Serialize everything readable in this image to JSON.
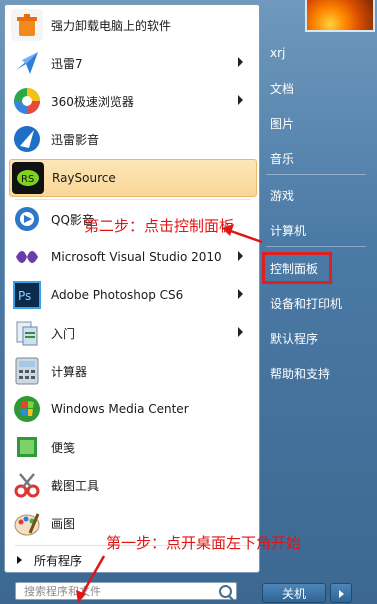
{
  "left_items": [
    {
      "label": "强力卸载电脑上的软件",
      "icon": "uninstall-icon",
      "arrow": false
    },
    {
      "label": "迅雷7",
      "icon": "xunlei-icon",
      "arrow": true
    },
    {
      "label": "360极速浏览器",
      "icon": "browser-icon",
      "arrow": true
    },
    {
      "label": "迅雷影音",
      "icon": "media-player-icon",
      "arrow": false
    },
    {
      "label": "RaySource",
      "icon": "raysource-icon",
      "arrow": false,
      "selected": true
    },
    {
      "label": "QQ影音",
      "icon": "qq-player-icon",
      "arrow": false
    },
    {
      "label": "Microsoft Visual Studio 2010",
      "icon": "visual-studio-icon",
      "arrow": true
    },
    {
      "label": "Adobe Photoshop CS6",
      "icon": "photoshop-icon",
      "arrow": true
    },
    {
      "label": "入门",
      "icon": "getting-started-icon",
      "arrow": true
    },
    {
      "label": "计算器",
      "icon": "calculator-icon",
      "arrow": false
    },
    {
      "label": "Windows Media Center",
      "icon": "media-center-icon",
      "arrow": false
    },
    {
      "label": "便笺",
      "icon": "sticky-notes-icon",
      "arrow": false
    },
    {
      "label": "截图工具",
      "icon": "snipping-tool-icon",
      "arrow": false
    },
    {
      "label": "画图",
      "icon": "paint-icon",
      "arrow": false
    }
  ],
  "all_programs": "所有程序",
  "search_placeholder": "搜索程序和文件",
  "right_items": {
    "user": "xrj",
    "documents": "文档",
    "pictures": "图片",
    "music": "音乐",
    "games": "游戏",
    "computer": "计算机",
    "control_panel": "控制面板",
    "devices": "设备和打印机",
    "default_programs": "默认程序",
    "help": "帮助和支持"
  },
  "shutdown_label": "关机",
  "annotations": {
    "step1": "第一步：点开桌面左下角开始",
    "step2": "第二步：点击控制面板"
  },
  "colors": {
    "annotation": "#e01515",
    "highlight_box": "#e02020",
    "selected_bg": "#f9d696"
  }
}
